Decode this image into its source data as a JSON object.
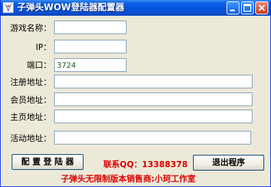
{
  "window": {
    "title": "子弹头WOW登陆器配置器",
    "colors": {
      "titlebar": "#0654de",
      "face": "#ece9d8",
      "red_text": "#dd0000",
      "value_text": "#1c5d2b"
    },
    "icons": [
      "app-icon",
      "minimize-icon",
      "maximize-icon",
      "close-icon"
    ]
  },
  "form": {
    "game_name": {
      "label": "游戏名称：",
      "value": ""
    },
    "ip": {
      "label": "IP：",
      "value": ""
    },
    "port": {
      "label": "端口：",
      "value": "3724"
    },
    "register_url": {
      "label": "注册地址：",
      "value": ""
    },
    "member_url": {
      "label": "会员地址：",
      "value": ""
    },
    "home_url": {
      "label": "主页地址：",
      "value": ""
    },
    "event_url": {
      "label": "活动地址：",
      "value": ""
    }
  },
  "buttons": {
    "configure": "配 置 登 陆 器",
    "exit": "退出程序"
  },
  "contact_qq": "联系QQ：13388378",
  "footer": "子弹头无限制版本销售商:小珂工作室"
}
